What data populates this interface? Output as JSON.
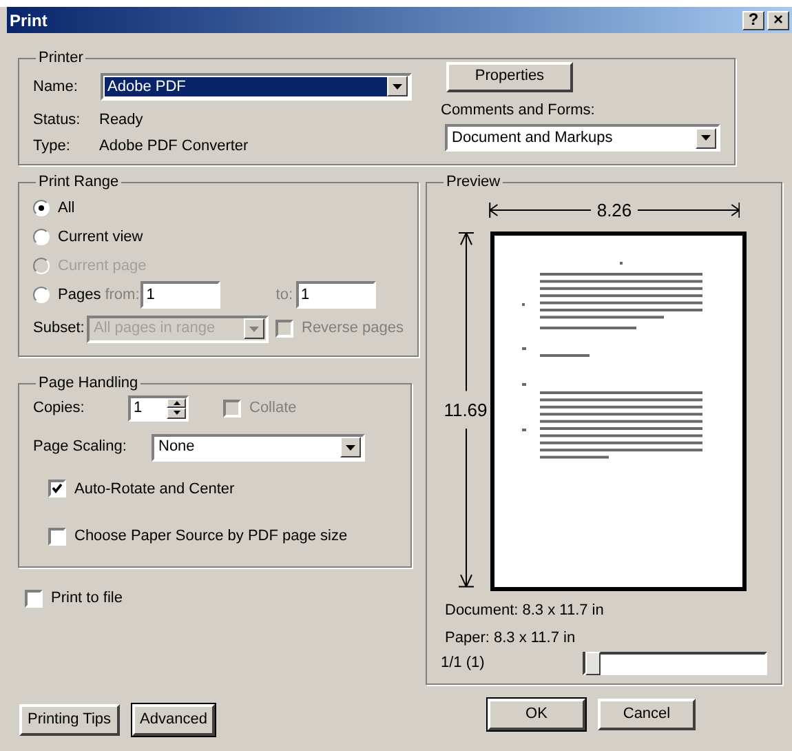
{
  "window": {
    "title": "Print",
    "title_buttons": [
      "?",
      "×"
    ]
  },
  "printer": {
    "legend": "Printer",
    "name_label": "Name:",
    "name_value": "Adobe PDF",
    "status_label": "Status:",
    "status_value": "Ready",
    "type_label": "Type:",
    "type_value": "Adobe PDF Converter",
    "properties_button": "Properties",
    "comments_label": "Comments and Forms:",
    "comments_value": "Document and Markups"
  },
  "print_range": {
    "legend": "Print Range",
    "options": [
      {
        "label": "All",
        "selected": true,
        "disabled": false
      },
      {
        "label": "Current view",
        "selected": false,
        "disabled": false
      },
      {
        "label": "Current page",
        "selected": false,
        "disabled": true
      },
      {
        "label": "Pages",
        "selected": false,
        "disabled": false
      }
    ],
    "from_label": "from:",
    "from_value": "1",
    "to_label": "to:",
    "to_value": "1",
    "page_fields_disabled": true,
    "subset_label": "Subset:",
    "subset_value": "All pages in range",
    "subset_disabled": true,
    "reverse": {
      "label": "Reverse pages",
      "checked": false,
      "disabled": true
    }
  },
  "page_handling": {
    "legend": "Page Handling",
    "copies_label": "Copies:",
    "copies_value": "1",
    "collate": {
      "label": "Collate",
      "checked": false,
      "disabled": true
    },
    "scaling_label": "Page Scaling:",
    "scaling_value": "None",
    "options": [
      {
        "label": "Auto-Rotate and Center",
        "checked": true
      },
      {
        "label": "Choose Paper Source by PDF page size",
        "checked": false
      }
    ]
  },
  "print_to_file": {
    "label": "Print to file",
    "checked": false
  },
  "preview": {
    "legend": "Preview",
    "width_label": "8.26",
    "height_label": "11.69",
    "document": "Document: 8.3 x 11.7 in",
    "paper": "Paper: 8.3 x 11.7 in",
    "page_counter": "1/1 (1)",
    "slider": {
      "level": 0
    }
  },
  "left_buttons": [
    {
      "label": "Printing Tips",
      "default": false
    },
    {
      "label": "Advanced",
      "default": true
    }
  ],
  "right_buttons": [
    {
      "label": "OK",
      "default": true
    },
    {
      "label": "Cancel",
      "default": false
    }
  ]
}
